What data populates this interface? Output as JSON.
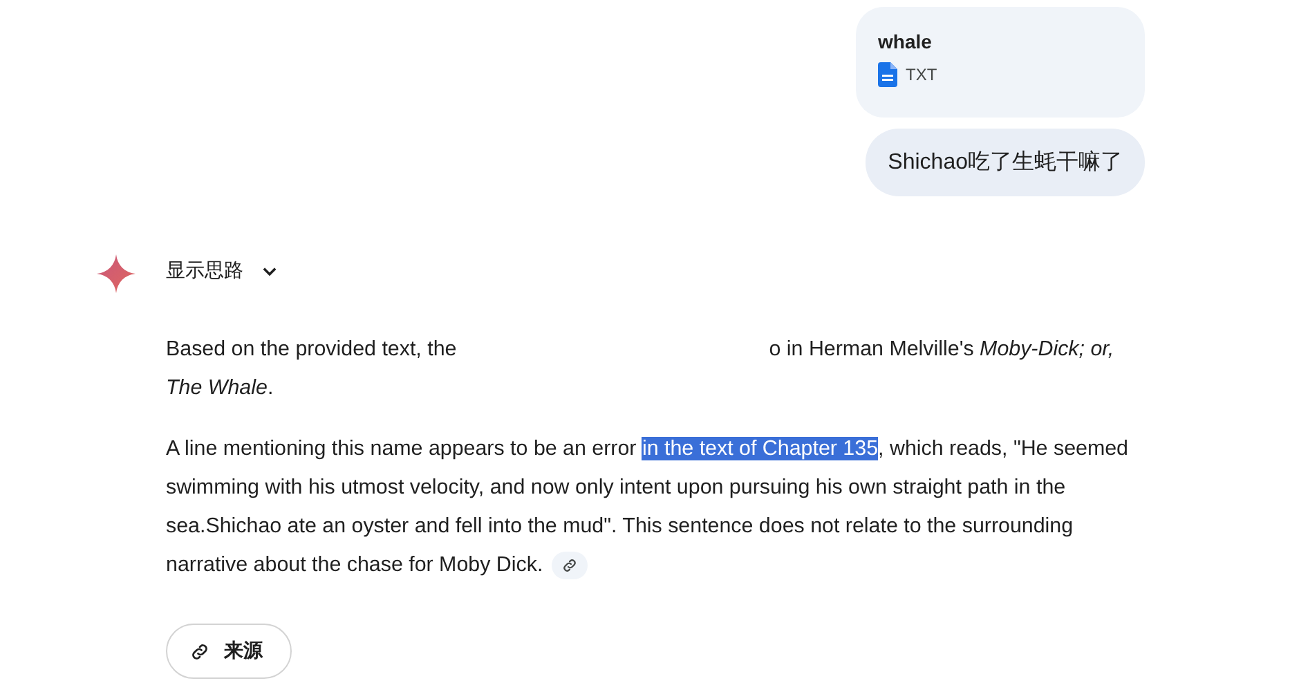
{
  "user_messages": [
    {
      "kind": "file",
      "name": "whale",
      "file_type": "TXT"
    },
    {
      "kind": "text",
      "text": "Shichao吃了生蚝干嘛了"
    }
  ],
  "response": {
    "thoughts_toggle": {
      "label": "显示思路",
      "expanded": false
    },
    "paragraphs": [
      {
        "kind": "split",
        "before": "Based on the provided text, the",
        "after": "o in Herman Melville's *Moby-Dick; or, The Whale*."
      },
      {
        "kind": "highlight",
        "before": "A line mentioning this name appears to be an error ",
        "selected": "in the text of Chapter 135",
        "after": ", which reads, \"He seemed swimming with his utmost velocity, and now only intent upon pursuing his own straight path in the sea.Shichao ate an oyster and fell into the mud\". This sentence does not relate to the surrounding narrative about the chase for Moby Dick.",
        "has_link": true
      }
    ],
    "sources_button": {
      "label": "来源"
    }
  }
}
